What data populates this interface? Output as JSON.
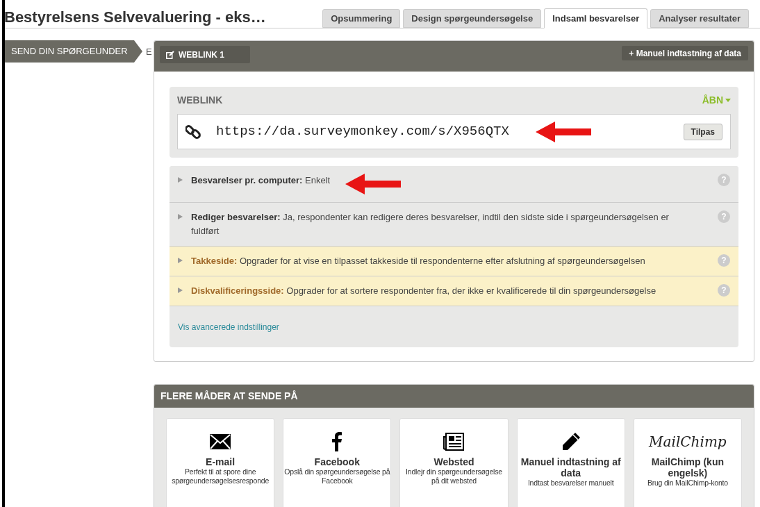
{
  "title": "Bestyrelsens Selvevaluering - eks…",
  "tabs": [
    {
      "label": "Opsummering",
      "selected": false
    },
    {
      "label": "Design spørgeundersøgelse",
      "selected": false
    },
    {
      "label": "Indsaml besvarelser",
      "selected": true
    },
    {
      "label": "Analyser resultater",
      "selected": false
    }
  ],
  "sidebar": {
    "step": "SEND DIN SPØRGEUNDER",
    "cut_text": "E"
  },
  "collector": {
    "tab": "WEBLINK 1",
    "manual_button": "+ Manuel indtastning af data",
    "weblink": {
      "heading": "WEBLINK",
      "open": "ÅBN",
      "url": "https://da.surveymonkey.com/s/X956QTX",
      "customize": "Tilpas"
    },
    "settings": [
      {
        "kind": "plain",
        "label": "Besvarelser pr. computer:",
        "text": "Enkelt",
        "arrow": true,
        "help": "?"
      },
      {
        "kind": "plain",
        "label": "Rediger besvarelser:",
        "text": "Ja, respondenter kan redigere deres besvarelser, indtil den sidste side i spørgeundersøgelsen er fuldført",
        "arrow": false,
        "help": "?"
      },
      {
        "kind": "upgrade",
        "label": "Takkeside:",
        "text": "Opgrader for at vise en tilpasset takkeside til respondenterne efter afslutning af spørgeundersøgelsen",
        "arrow": false,
        "help": "?"
      },
      {
        "kind": "upgrade",
        "label": "Diskvalificeringsside:",
        "text": "Opgrader for at sortere respondenter fra, der ikke er kvalificerede til din spørgeundersøgelse",
        "arrow": false,
        "help": "?"
      }
    ],
    "advanced_link": "Vis avancerede indstillinger"
  },
  "more_ways": {
    "heading": "FLERE MÅDER AT SENDE PÅ",
    "cards": [
      {
        "kind": "email",
        "title": "E-mail",
        "text": "Perfekt til at spore dine spørgeundersøgelsesresponde"
      },
      {
        "kind": "facebook",
        "title": "Facebook",
        "text": "Opslå din spørgeundersøgelse på Facebook"
      },
      {
        "kind": "website",
        "title": "Websted",
        "text": "Indlejr din spørgeundersøgelse på dit websted"
      },
      {
        "kind": "manual",
        "title": "Manuel indtastning af data",
        "text": "Indtast besvarelser manuelt"
      },
      {
        "kind": "mailchimp",
        "logo": "MailChimp",
        "title": "MailChimp (kun engelsk)",
        "text": "Brug din MailChimp-konto"
      }
    ]
  }
}
